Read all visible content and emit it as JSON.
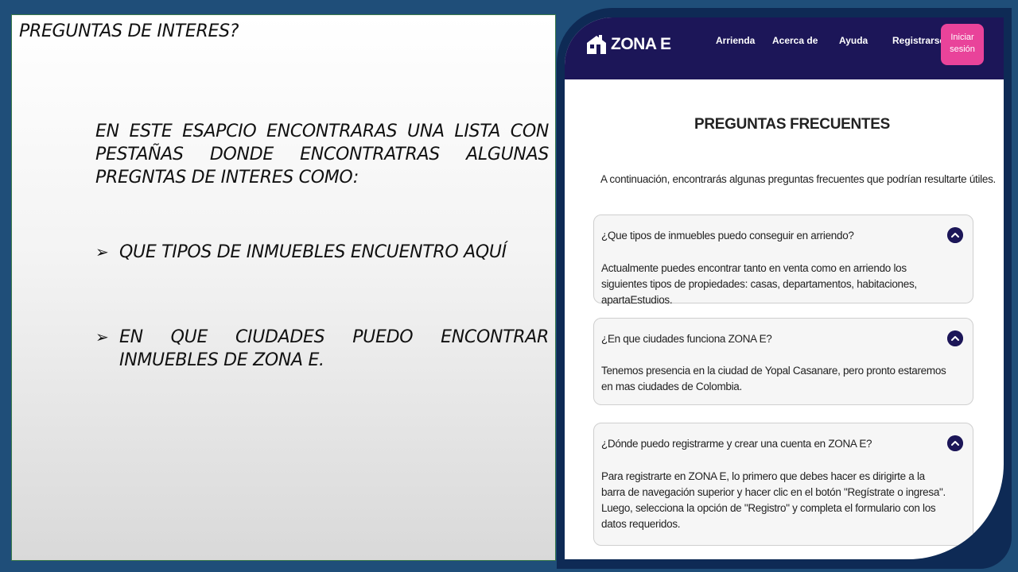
{
  "slide": {
    "title": "PREGUNTAS DE INTERES?",
    "intro": "EN ESTE ESAPCIO ENCONTRARAS UNA LISTA CON PESTAÑAS DONDE ENCONTRATRAS ALGUNAS PREGNTAS DE INTERES COMO:",
    "bullets": [
      "QUE TIPOS DE INMUEBLES ENCUENTRO AQUÍ",
      "EN QUE CIUDADES PUEDO ENCONTRAR INMUEBLES DE ZONA E."
    ],
    "bullet_symbol": "➢"
  },
  "site": {
    "brand": "ZONA E",
    "nav": {
      "arrienda": "Arrienda",
      "acerca": "Acerca de",
      "ayuda": "Ayuda",
      "registrarse": "Registrarse",
      "login_line1": "Iniciar",
      "login_line2": "sesión"
    },
    "faq_title": "PREGUNTAS FRECUENTES",
    "faq_intro": "A continuación, encontrarás algunas preguntas frecuentes que podrían resultarte útiles.",
    "faqs": [
      {
        "question": "¿Que tipos de inmuebles puedo conseguir en arriendo?",
        "answer": "Actualmente puedes encontrar tanto en venta como en arriendo los siguientes tipos de propiedades: casas, departamentos, habitaciones, apartaEstudios."
      },
      {
        "question": "¿En que ciudades funciona ZONA E?",
        "answer": "Tenemos presencia en la ciudad de Yopal Casanare, pero pronto estaremos en mas ciudades de Colombia."
      },
      {
        "question": "¿Dónde puedo registrarme y crear una cuenta en ZONA E?",
        "answer": "Para registrarte en ZONA E, lo primero que debes hacer es dirigirte a la barra de navegación superior y hacer clic en el botón \"Regístrate o ingresa\". Luego, selecciona la opción de \"Registro\" y completa el formulario con los datos requeridos."
      }
    ]
  },
  "colors": {
    "background": "#1f4e79",
    "navbar": "#1c1658",
    "login_button": "#e9439a",
    "frame": "#0e2a55"
  }
}
